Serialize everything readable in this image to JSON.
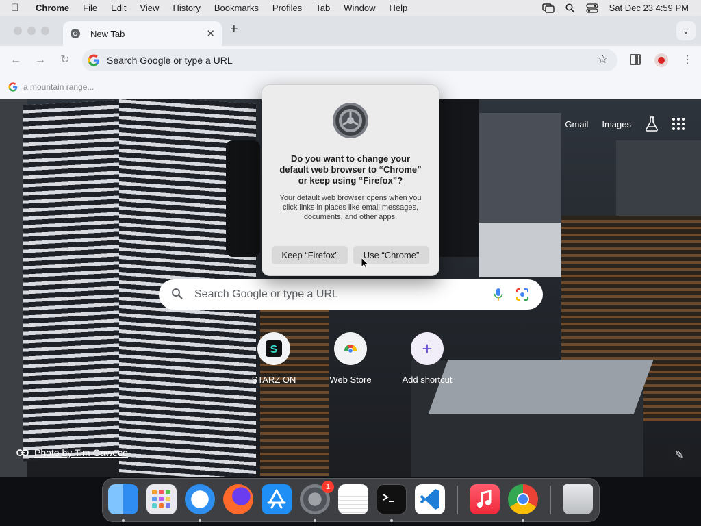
{
  "menubar": {
    "app_name": "Chrome",
    "items": [
      "File",
      "Edit",
      "View",
      "History",
      "Bookmarks",
      "Profiles",
      "Tab",
      "Window",
      "Help"
    ],
    "datetime": "Sat Dec 23  4:59 PM"
  },
  "tabs": [
    {
      "title": "New Tab",
      "active": true
    }
  ],
  "omnibox": {
    "placeholder": "Search Google or type a URL"
  },
  "bookmarks_bar": {
    "suggestion": "a mountain range..."
  },
  "ntp": {
    "header_links": {
      "gmail": "Gmail",
      "images": "Images"
    },
    "search": {
      "placeholder": "Search Google or type a URL"
    },
    "shortcuts": [
      {
        "label": "STARZ ON",
        "icon": "starz-icon"
      },
      {
        "label": "Web Store",
        "icon": "chrome-web-store-icon"
      },
      {
        "label": "Add shortcut",
        "icon": "plus-icon"
      }
    ],
    "photo_credit": "Photo by Tim Gaweco"
  },
  "dialog": {
    "title": "Do you want to change your default web browser to “Chrome” or keep using “Firefox”?",
    "message": "Your default web browser opens when you click links in places like email messages, documents, and other apps.",
    "keep_button": "Keep “Firefox”",
    "use_button": "Use “Chrome”"
  },
  "dock": {
    "apps": [
      "Finder",
      "Launchpad",
      "Safari",
      "Firefox",
      "App Store",
      "System Settings",
      "TextEdit",
      "Terminal",
      "Visual Studio Code",
      "Music",
      "Google Chrome",
      "Trash"
    ],
    "settings_badge": "1"
  }
}
